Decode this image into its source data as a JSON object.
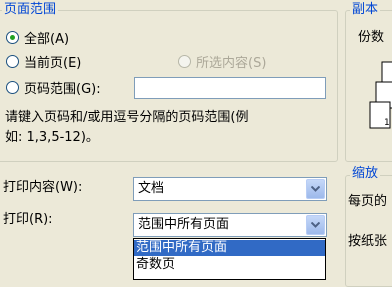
{
  "page_range": {
    "title": "页面范围",
    "options": [
      {
        "label": "全部(A)",
        "checked": true,
        "enabled": true
      },
      {
        "label": "当前页(E)",
        "checked": false,
        "enabled": true
      },
      {
        "label": "所选内容(S)",
        "checked": false,
        "enabled": false
      },
      {
        "label": "页码范围(G):",
        "checked": false,
        "enabled": true
      }
    ],
    "page_numbers_value": "",
    "hint_line1": "请键入页码和/或用逗号分隔的页码范围(例",
    "hint_line2": "如: 1,3,5-12)。"
  },
  "copies": {
    "title": "副本",
    "count_label": "份数",
    "collate_page_number": "1"
  },
  "print_what": {
    "label": "打印内容(W):",
    "value": "文档"
  },
  "print": {
    "label": "打印(R):",
    "value": "范围中所有页面",
    "options": [
      "范围中所有页面",
      "奇数页"
    ],
    "selected_index": 0
  },
  "zoom": {
    "title": "缩放",
    "pages_per_sheet_label": "每页的",
    "scale_to_paper_label": "按纸张"
  },
  "colors": {
    "group_title": "#0046d5",
    "selection": "#316ac5",
    "background": "#ece9d8"
  }
}
